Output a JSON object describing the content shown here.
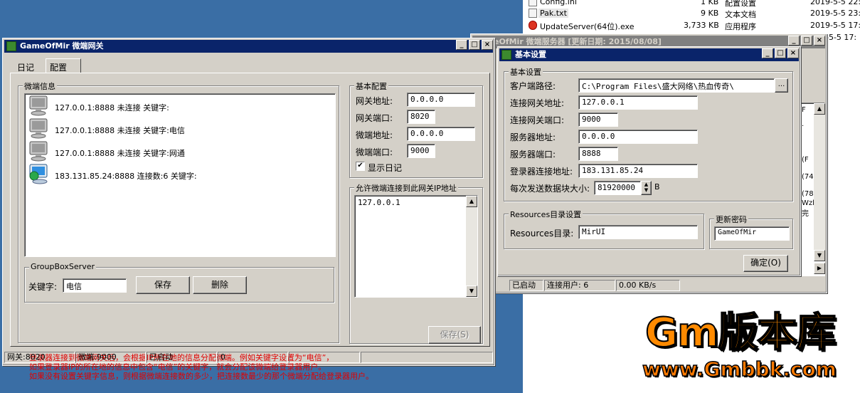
{
  "explorer": {
    "files": [
      {
        "name": "Config.ini",
        "size": "1 KB",
        "type": "配置设置",
        "date": "2019-5-5 22:"
      },
      {
        "name": "Pak.txt",
        "size": "9 KB",
        "type": "文本文档",
        "date": "2019-5-5 23:"
      },
      {
        "name": "UpdateServer(64位).exe",
        "size": "3,733 KB",
        "type": "应用程序",
        "date": "2019-5-5 17:"
      },
      {
        "name": "",
        "size": "",
        "type": "",
        "date": "-5-5 17:"
      }
    ]
  },
  "gateway": {
    "title": "GameOfMir 微端网关",
    "tabs": [
      {
        "label": "日记"
      },
      {
        "label": "配置"
      }
    ],
    "server_group_label": "微端信息",
    "servers": [
      {
        "text": "127.0.0.1:8888 未连接 关键字:"
      },
      {
        "text": "127.0.0.1:8888 未连接 关键字:电信"
      },
      {
        "text": "127.0.0.1:8888 未连接 关键字:网通"
      },
      {
        "text": "183.131.85.24:8888 连接数:6 关键字:"
      }
    ],
    "groupbox_label": "GroupBoxServer",
    "keyword_label": "关键字:",
    "keyword_value": "电信",
    "save_label": "保存",
    "delete_label": "删除",
    "basic_group_label": "基本配置",
    "gateway_addr_label": "网关地址:",
    "gateway_addr": "0.0.0.0",
    "gateway_port_label": "网关端口:",
    "gateway_port": "8020",
    "micro_addr_label": "微端地址:",
    "micro_addr": "0.0.0.0",
    "micro_port_label": "微端端口:",
    "micro_port": "9000",
    "show_log_label": "显示日记",
    "allow_group_label": "允许微端连接到此网关IP地址",
    "allowed_ip": "127.0.0.1",
    "notes": [
      "登录器连接到微端网关后，会根据IP所在地的信息分配微端。例如关键字设置为“电信”，",
      "如果登录器IP的所在地的信息中包含“电信”的关键字，就会分配该微端给登录器用户。",
      "如果没有设置关键字信息，则根据微端连接数的多少，把连接数最少的那个微端分配给登录器用户。"
    ],
    "save_s_label": "保存(S)",
    "status": [
      "网关:8020",
      "微端:9000",
      "已启动",
      "0"
    ]
  },
  "server": {
    "title": "GameOfMir 微端服务器 [更新日期: 2015/08/08]",
    "title_visible": "eOfMir 微端服务器 [更新日期: 2015/08/08]",
    "status": [
      "已启动",
      "连接用户: 6",
      "0.00 KB/s"
    ],
    "side_text": [
      "F",
      ".",
      "(F",
      "(74",
      "(78",
      "Wzl",
      "完"
    ]
  },
  "settings": {
    "title": "基本设置",
    "basic_group_label": "基本设置",
    "client_path_label": "客户端路径:",
    "client_path": "C:\\Program Files\\盛大网络\\热血传奇\\",
    "browse_label": "...",
    "conn_gw_addr_label": "连接网关地址:",
    "conn_gw_addr": "127.0.0.1",
    "conn_gw_port_label": "连接网关端口:",
    "conn_gw_port": "9000",
    "server_addr_label": "服务器地址:",
    "server_addr": "0.0.0.0",
    "server_port_label": "服务器端口:",
    "server_port": "8888",
    "login_addr_label": "登录器连接地址:",
    "login_addr": "183.131.85.24",
    "block_size_label": "每次发送数据块大小:",
    "block_size": "81920000",
    "block_unit": "B",
    "resources_group_label": "Resources目录设置",
    "resources_label": "Resources目录:",
    "resources_value": "MirUI",
    "pwd_group_label": "更新密码",
    "pwd_value": "GameOfMir",
    "ok_label": "确定(O)"
  },
  "watermark": {
    "line1": "Gm版本库",
    "line2": "www.Gmbbk.com"
  }
}
